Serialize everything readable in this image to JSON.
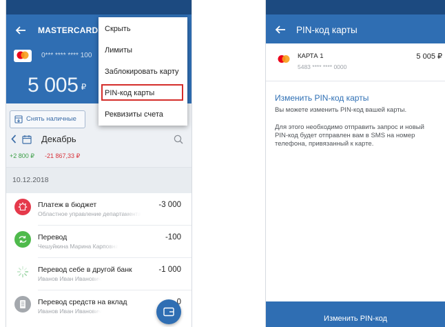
{
  "theme": {
    "status_bar": "#1c4a80",
    "primary": "#2f6eb3",
    "link": "#2e6fb4",
    "income": "#3a9e45",
    "expense": "#d8333b",
    "highlight_border": "#d42d2a"
  },
  "left_screen": {
    "header": {
      "back_icon": "arrow-left-icon",
      "title": "MASTERCARD"
    },
    "card": {
      "logo": "mastercard-logo",
      "number_masked": "0*** **** **** 100"
    },
    "balance": {
      "amount": "5 005",
      "currency": "₽"
    },
    "menu": {
      "items": [
        {
          "label": "Скрыть",
          "highlighted": false
        },
        {
          "label": "Лимиты",
          "highlighted": false
        },
        {
          "label": "Заблокировать карту",
          "highlighted": false
        },
        {
          "label": "PIN-код карты",
          "highlighted": true
        },
        {
          "label": "Реквизиты счета",
          "highlighted": false
        }
      ]
    },
    "cash_button": {
      "icon": "cash-withdraw-icon",
      "label": "Снять наличные"
    },
    "month_nav": {
      "prev_icon": "chevron-left-icon",
      "calendar_icon": "calendar-icon",
      "month": "Декабрь",
      "search_icon": "search-icon"
    },
    "totals": {
      "income": "+2 800 ₽",
      "expense": "-21 867,33 ₽"
    },
    "date_header": "10.12.2018",
    "transactions": [
      {
        "icon": "budget-emblem-icon",
        "icon_color": "#e5394b",
        "title": "Платеж в бюджет",
        "subtitle": "Областное управление департамента",
        "amount": "-3 000"
      },
      {
        "icon": "transfer-arrows-icon",
        "icon_color": "#4fba4c",
        "title": "Перевод",
        "subtitle": "Чешуйкина Марина Карповна",
        "amount": "-100"
      },
      {
        "icon": "loading-spinner-icon",
        "icon_color": "#8fd09a",
        "title": "Перевод себе в другой банк",
        "subtitle": "Иванов Иван Иванович",
        "amount": "-1 000"
      },
      {
        "icon": "document-icon",
        "icon_color": "#a4a8ad",
        "title": "Перевод средств на вклад",
        "subtitle": "Иванов Иван Иванович",
        "amount": "0"
      }
    ],
    "fab": {
      "icon": "wallet-icon"
    }
  },
  "right_screen": {
    "header": {
      "back_icon": "arrow-left-icon",
      "title": "PIN-код карты"
    },
    "card": {
      "logo": "mastercard-logo",
      "name": "КАРТА 1",
      "number_masked": "5483 **** **** 0000",
      "balance": "5 005 ₽"
    },
    "section_title": "Изменить PIN-код карты",
    "description": "Вы можете изменить PIN-код вашей карты.",
    "info_lines": [
      "Для этого необходимо отправить запрос и новый",
      "PIN-код будет отправлен вам в SMS на номер",
      "телефона, привязанный к карте."
    ],
    "submit_button": "Изменить PIN-код"
  }
}
